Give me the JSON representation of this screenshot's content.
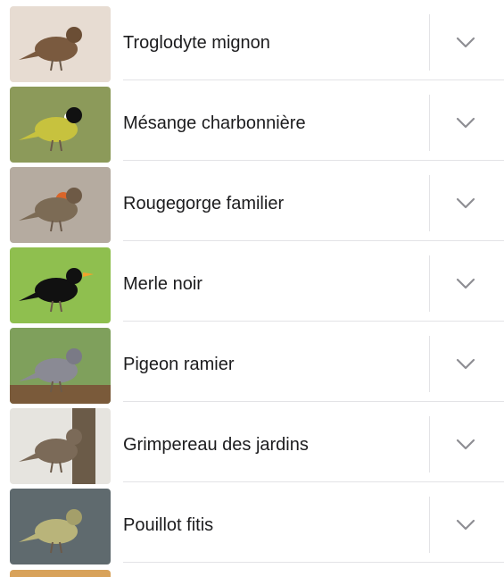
{
  "birds": [
    {
      "name": "Troglodyte mignon",
      "icon": "wren-photo",
      "bg": "#e7dcd2",
      "body": "#7a5a3f"
    },
    {
      "name": "Mésange charbonnière",
      "icon": "great-tit-photo",
      "bg": "#8c9a5a",
      "body": "#c7c23e"
    },
    {
      "name": "Rougegorge familier",
      "icon": "robin-photo",
      "bg": "#b5aba0",
      "body": "#7c6b55"
    },
    {
      "name": "Merle noir",
      "icon": "blackbird-photo",
      "bg": "#8fbf4f",
      "body": "#111111"
    },
    {
      "name": "Pigeon ramier",
      "icon": "wood-pigeon-photo",
      "bg": "#7fa05c",
      "body": "#8a8a94"
    },
    {
      "name": "Grimpereau des jardins",
      "icon": "treecreeper-photo",
      "bg": "#e6e4df",
      "body": "#7b6a58"
    },
    {
      "name": "Pouillot fitis",
      "icon": "willow-warbler-photo",
      "bg": "#5f6a6e",
      "body": "#b9b47a"
    }
  ],
  "expand_icon": "chevron-down-icon",
  "colors": {
    "text": "#1c1c1e",
    "separator": "#e3e3e6",
    "chevron": "#8e8e93"
  }
}
